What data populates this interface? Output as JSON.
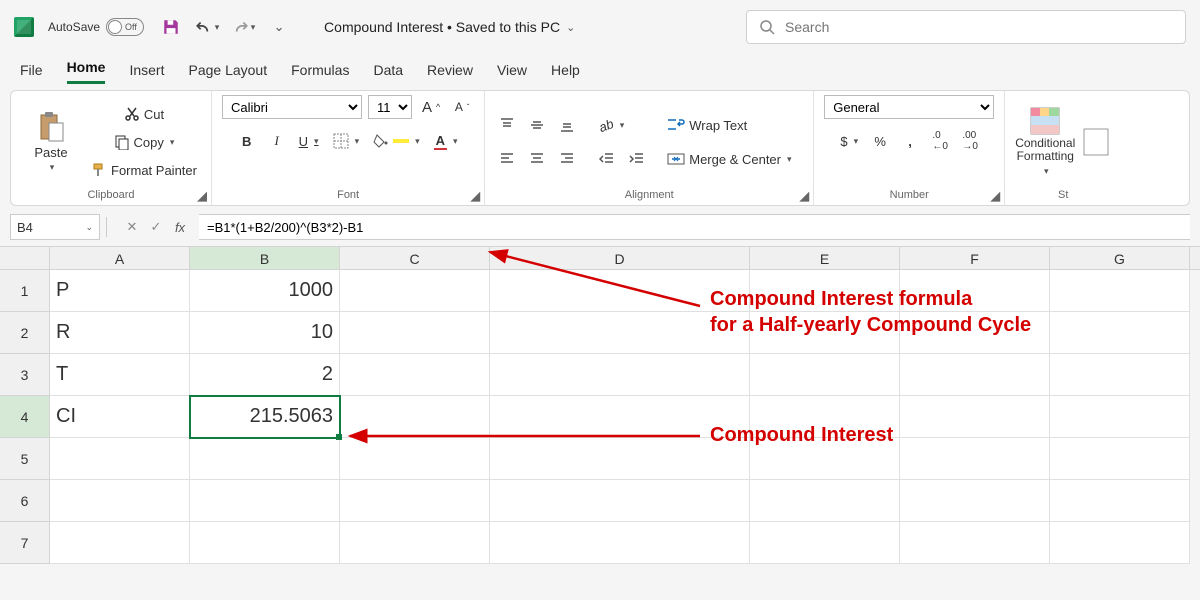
{
  "titlebar": {
    "autosave_label": "AutoSave",
    "autosave_state": "Off",
    "doc_title": "Compound Interest • Saved to this PC",
    "search_placeholder": "Search"
  },
  "menu": {
    "tabs": [
      "File",
      "Home",
      "Insert",
      "Page Layout",
      "Formulas",
      "Data",
      "Review",
      "View",
      "Help"
    ],
    "active": "Home"
  },
  "ribbon": {
    "clipboard": {
      "paste": "Paste",
      "cut": "Cut",
      "copy": "Copy",
      "format_painter": "Format Painter",
      "group_label": "Clipboard"
    },
    "font": {
      "name": "Calibri",
      "size": "11",
      "group_label": "Font"
    },
    "alignment": {
      "wrap": "Wrap Text",
      "merge": "Merge & Center",
      "group_label": "Alignment"
    },
    "number": {
      "format": "General",
      "group_label": "Number"
    },
    "styles": {
      "cond": "Conditional",
      "cond2": "Formatting",
      "styles_label": "St"
    }
  },
  "formula_bar": {
    "name_box": "B4",
    "formula": "=B1*(1+B2/200)^(B3*2)-B1"
  },
  "grid": {
    "cols": [
      "A",
      "B",
      "C",
      "D",
      "E",
      "F",
      "G"
    ],
    "rows": [
      {
        "n": 1,
        "A": "P",
        "B": "1000"
      },
      {
        "n": 2,
        "A": "R",
        "B": "10"
      },
      {
        "n": 3,
        "A": "T",
        "B": "2"
      },
      {
        "n": 4,
        "A": "CI",
        "B": "215.5063"
      },
      {
        "n": 5
      },
      {
        "n": 6
      },
      {
        "n": 7
      }
    ],
    "selected": {
      "row": 4,
      "col": "B"
    }
  },
  "annotations": {
    "formula_label_l1": "Compound Interest formula",
    "formula_label_l2": "for a Half-yearly Compound Cycle",
    "result_label": "Compound Interest"
  }
}
